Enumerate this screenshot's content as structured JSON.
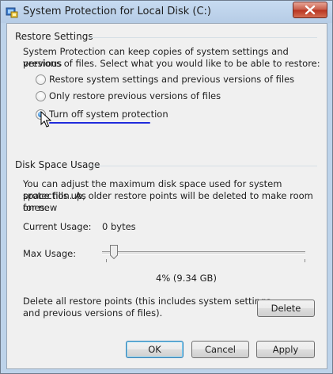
{
  "window": {
    "title": "System Protection for Local Disk (C:)"
  },
  "restore_settings": {
    "heading": "Restore Settings",
    "description_line1": "System Protection can keep copies of system settings and previous",
    "description_line2": "versions of files. Select what you would like to be able to restore:",
    "options": [
      {
        "label": "Restore system settings and previous versions of files",
        "checked": false
      },
      {
        "label": "Only restore previous versions of files",
        "checked": false
      },
      {
        "label": "Turn off system protection",
        "checked": true
      }
    ]
  },
  "disk_space": {
    "heading": "Disk Space Usage",
    "description_line1": "You can adjust the maximum disk space used for system protection. As",
    "description_line2": "space fills up, older restore points will be deleted to make room for new",
    "description_line3": "ones.",
    "current_usage_label": "Current Usage:",
    "current_usage_value": "0 bytes",
    "max_usage_label": "Max Usage:",
    "max_usage_percent": 4,
    "max_usage_text": "4% (9.34 GB)",
    "delete_text_line1": "Delete all restore points (this includes system settings",
    "delete_text_line2": "and previous versions of files).",
    "delete_button": "Delete"
  },
  "buttons": {
    "ok": "OK",
    "cancel": "Cancel",
    "apply": "Apply"
  },
  "icons": {
    "app": "system-protection-icon",
    "close": "close-icon",
    "cursor": "mouse-pointer-icon"
  },
  "colors": {
    "accent_underline": "#1f2bdc",
    "close_button": "#c75a47"
  }
}
